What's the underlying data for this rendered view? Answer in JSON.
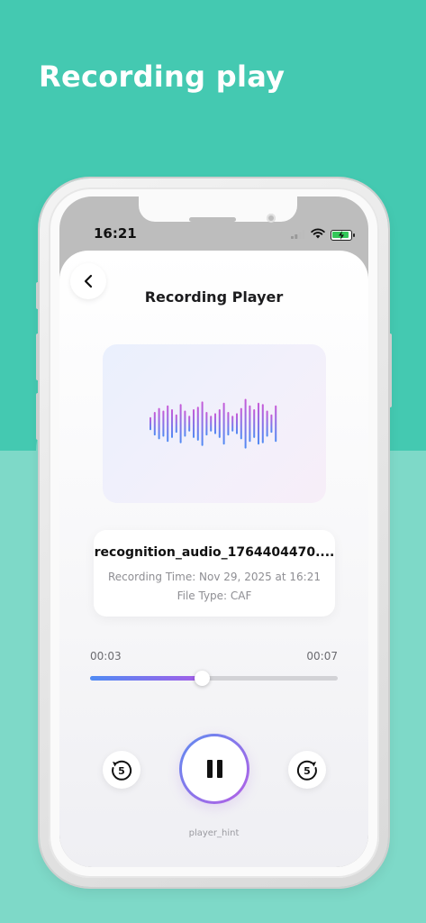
{
  "headline": "Recording play",
  "status_bar": {
    "time": "16:21",
    "icons": [
      "signal-icon",
      "wifi-icon",
      "battery-charging-icon"
    ]
  },
  "nav": {
    "back_icon": "chevron-left-icon",
    "title": "Recording Player"
  },
  "waveform": {
    "levels": [
      0.25,
      0.45,
      0.6,
      0.5,
      0.7,
      0.55,
      0.35,
      0.75,
      0.5,
      0.3,
      0.55,
      0.65,
      0.85,
      0.45,
      0.3,
      0.4,
      0.55,
      0.8,
      0.45,
      0.3,
      0.4,
      0.6,
      0.95,
      0.7,
      0.55,
      0.8,
      0.75,
      0.5,
      0.35,
      0.7
    ],
    "colors": {
      "top": "#c85ad8",
      "bottom": "#4f8bf4"
    }
  },
  "file_info": {
    "name": "recognition_audio_1764404470....",
    "recording_time": "Recording Time: Nov 29, 2025 at 16:21",
    "file_type": "File Type: CAF"
  },
  "playback": {
    "current": "00:03",
    "duration": "00:07",
    "progress": 0.45,
    "state": "playing"
  },
  "controls": {
    "rewind_label": "5",
    "forward_label": "5",
    "rewind_icon": "rewind-5-icon",
    "forward_icon": "forward-5-icon",
    "main_icon": "pause-icon"
  },
  "hint": "player_hint",
  "colors": {
    "bg_top": "#44c9b1",
    "bg_bottom": "#7ed9c8",
    "accent_start": "#4f8bf4",
    "accent_end": "#a55ee8"
  }
}
